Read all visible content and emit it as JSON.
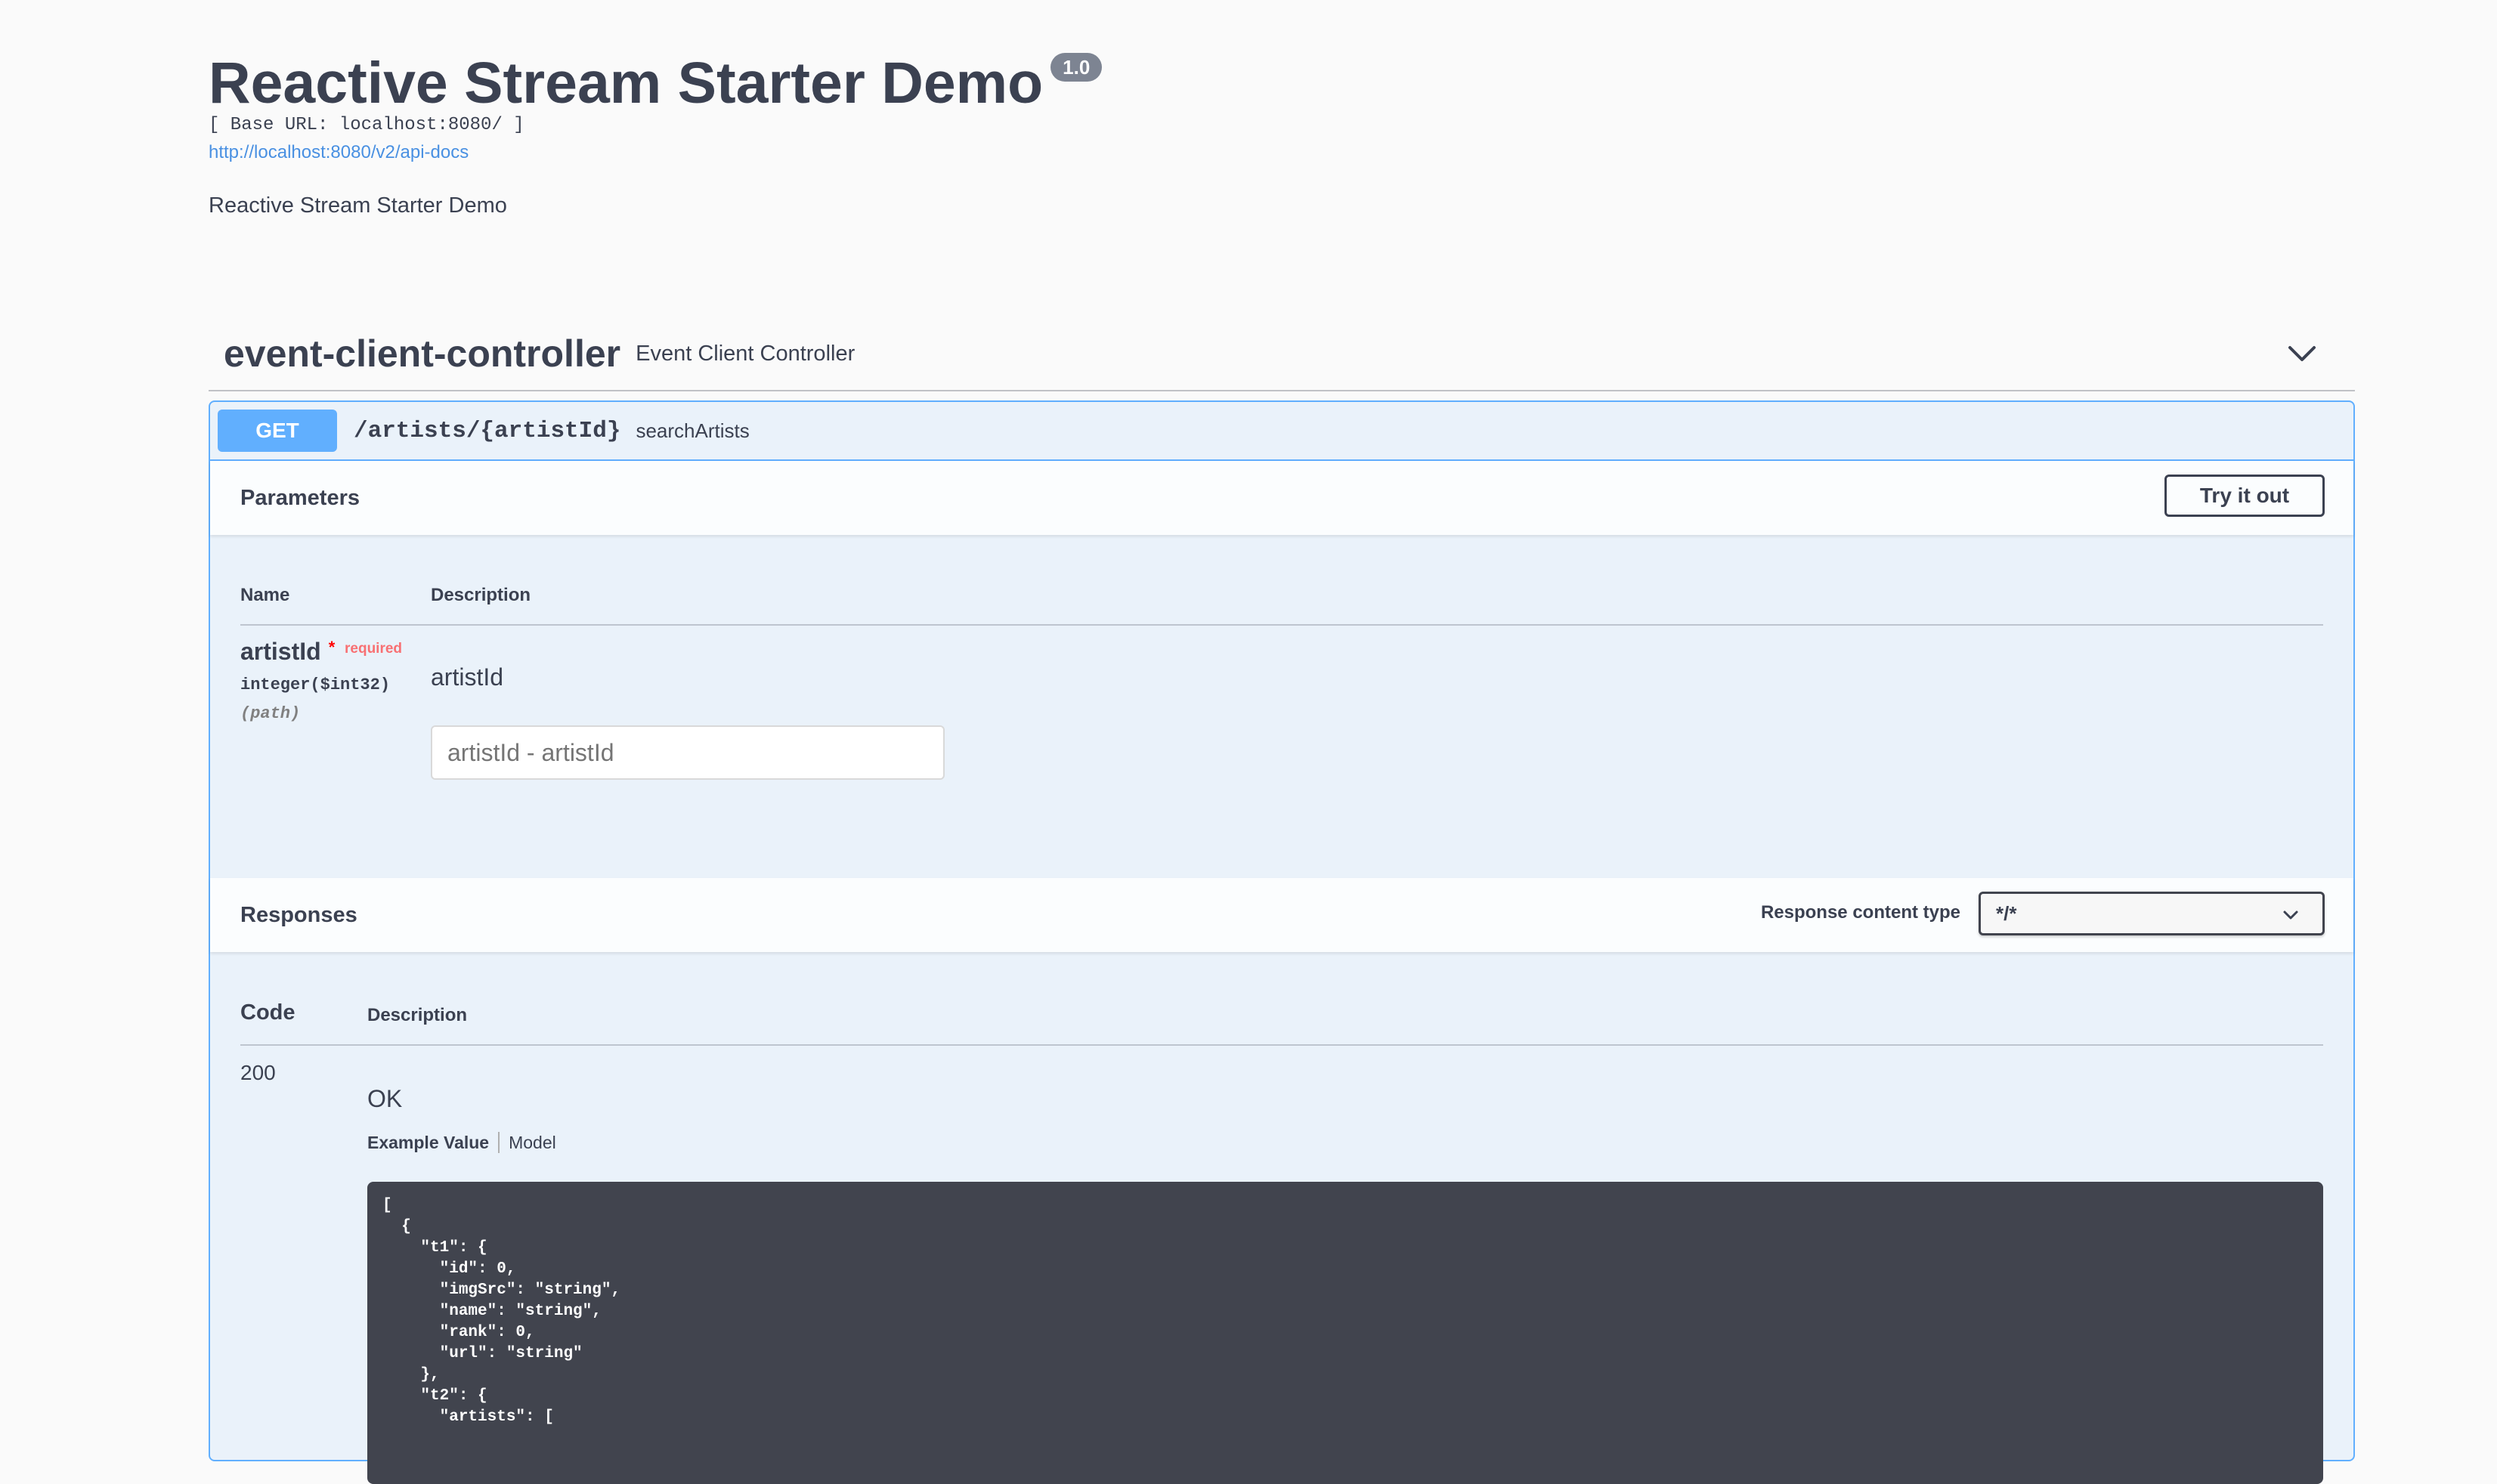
{
  "info": {
    "title": "Reactive Stream Starter Demo",
    "version": "1.0",
    "base_url": "[ Base URL: localhost:8080/ ]",
    "api_docs_url": "http://localhost:8080/v2/api-docs",
    "description": "Reactive Stream Starter Demo"
  },
  "tag": {
    "name": "event-client-controller",
    "description": "Event Client Controller",
    "chevron_icon": "chevron-down-icon"
  },
  "operation": {
    "method": "GET",
    "path": "/artists/{artistId}",
    "summary": "searchArtists",
    "accent_color": "#61affe"
  },
  "parameters": {
    "title": "Parameters",
    "try_label": "Try it out",
    "col_name": "Name",
    "col_description": "Description",
    "items": [
      {
        "name": "artistId",
        "required_star": "*",
        "required_label": "required",
        "type": "integer($int32)",
        "in": "(path)",
        "description": "artistId",
        "placeholder": "artistId - artistId"
      }
    ]
  },
  "responses": {
    "title": "Responses",
    "content_type_label": "Response content type",
    "content_type_value": "*/*",
    "col_code": "Code",
    "col_description": "Description",
    "items": [
      {
        "code": "200",
        "description": "OK",
        "tab_example": "Example Value",
        "tab_model": "Model",
        "example": "[\n  {\n    \"t1\": {\n      \"id\": 0,\n      \"imgSrc\": \"string\",\n      \"name\": \"string\",\n      \"rank\": 0,\n      \"url\": \"string\"\n    },\n    \"t2\": {\n      \"artists\": ["
      }
    ]
  }
}
